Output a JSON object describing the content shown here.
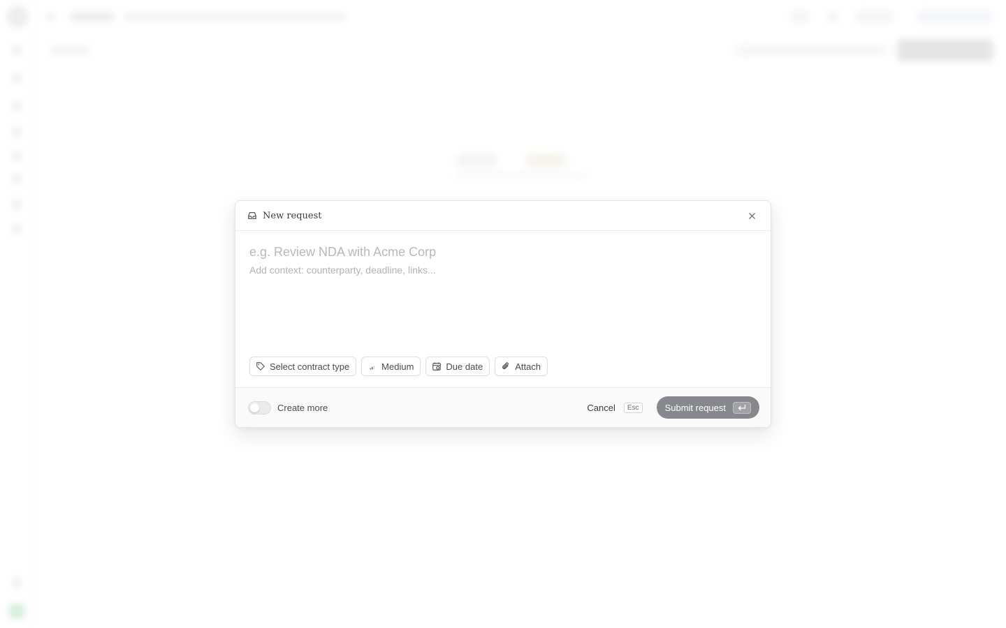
{
  "dialog": {
    "title": "New request",
    "title_placeholder": "e.g. Review NDA with Acme Corp",
    "description_placeholder": "Add context: counterparty, deadline, links...",
    "chips": {
      "contract_type": "Select contract type",
      "priority": "Medium",
      "due_date": "Due date",
      "attach": "Attach"
    },
    "footer": {
      "create_more_label": "Create more",
      "create_more_enabled": false,
      "cancel_label": "Cancel",
      "cancel_shortcut": "Esc",
      "submit_label": "Submit request"
    }
  },
  "icons": {
    "header": "inbox-icon",
    "close": "close-icon",
    "contract_type": "tag-icon",
    "priority": "signal-bars-icon",
    "due_date": "calendar-icon",
    "attach": "paperclip-icon",
    "submit": "enter-key-icon"
  },
  "colors": {
    "submit_button": "#86888d",
    "placeholder": "#b9b9b9"
  }
}
